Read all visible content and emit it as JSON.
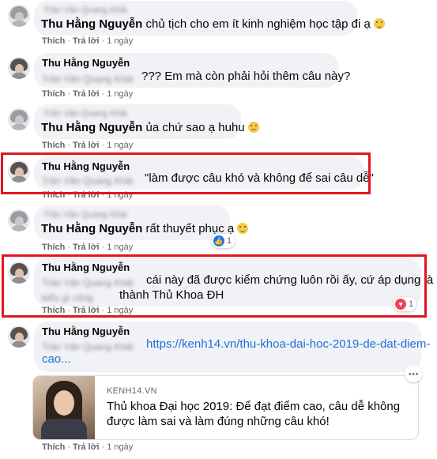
{
  "comments": [
    {
      "id": 1,
      "author": "Thu Hằng Nguyễn",
      "blurred_author": "Trần Văn Quang Khải",
      "text": "chủ tịch cho em ít kinh nghiệm học tập đi ạ",
      "emoji": "smile-emoji",
      "actions": {
        "like": "Thích",
        "reply": "Trả lời",
        "time": "1 ngày"
      }
    },
    {
      "id": 2,
      "author": "Thu Hằng Nguyễn",
      "blurred_mention": "Trần Văn Quang Khải",
      "text": "??? Em mà còn phải hỏi thêm câu này?",
      "actions": {
        "like": "Thích",
        "reply": "Trả lời",
        "time": "1 ngày"
      }
    },
    {
      "id": 3,
      "author": "Thu Hằng Nguyễn",
      "blurred_author": "Trần Văn Quang Khải",
      "text": "ủa chứ sao ạ huhu",
      "emoji": "sad-emoji",
      "actions": {
        "like": "Thích",
        "reply": "Trả lời",
        "time": "1 ngày"
      }
    },
    {
      "id": 4,
      "author": "Thu Hằng Nguyễn",
      "blurred_mention": "Trần Văn Quang Khải",
      "text": "\"làm được câu khó và không để sai câu dễ\"",
      "actions": {
        "like": "Thích",
        "reply": "Trả lời",
        "time": "1 ngày"
      }
    },
    {
      "id": 5,
      "author": "Thu Hằng Nguyễn",
      "blurred_author": "Trần Văn Quang Khải",
      "text": "rất thuyết phục ạ",
      "emoji": "grin-emoji",
      "reaction_count": "1",
      "actions": {
        "like": "Thích",
        "reply": "Trả lời",
        "time": "1 ngày"
      }
    },
    {
      "id": 6,
      "author": "Thu Hằng Nguyễn",
      "blurred_mention": "Trần Văn Quang Khải",
      "text_line1": "cái này đã được kiểm chứng luôn rồi ấy, cứ áp dụng là",
      "text_line2_prefix_blurred": "kiểu gì cũng",
      "text_line2": "thành Thủ Khoa ĐH",
      "reaction_count": "1",
      "actions": {
        "like": "Thích",
        "reply": "Trả lời",
        "time": "1 ngày"
      }
    },
    {
      "id": 7,
      "author": "Thu Hằng Nguyễn",
      "blurred_mention": "Trần Văn Quang Khải",
      "link_line1": "https://kenh14.vn/thu-khoa-dai-hoc-2019-de-dat-diem-",
      "link_line2": "cao...",
      "preview": {
        "site": "KENH14.VN",
        "title_line1": "Thủ khoa Đại học 2019: Để đạt điểm cao, câu dễ không",
        "title_line2": "được làm sai và làm đúng những câu khó!"
      },
      "actions": {
        "like": "Thích",
        "reply": "Trả lời",
        "time": "1 ngày"
      }
    }
  ],
  "colors": {
    "bubble": "#f0f2f5",
    "highlight_border": "#e0161e",
    "link": "#216fdb",
    "like": "#1877f2",
    "heart": "#f33e58"
  }
}
